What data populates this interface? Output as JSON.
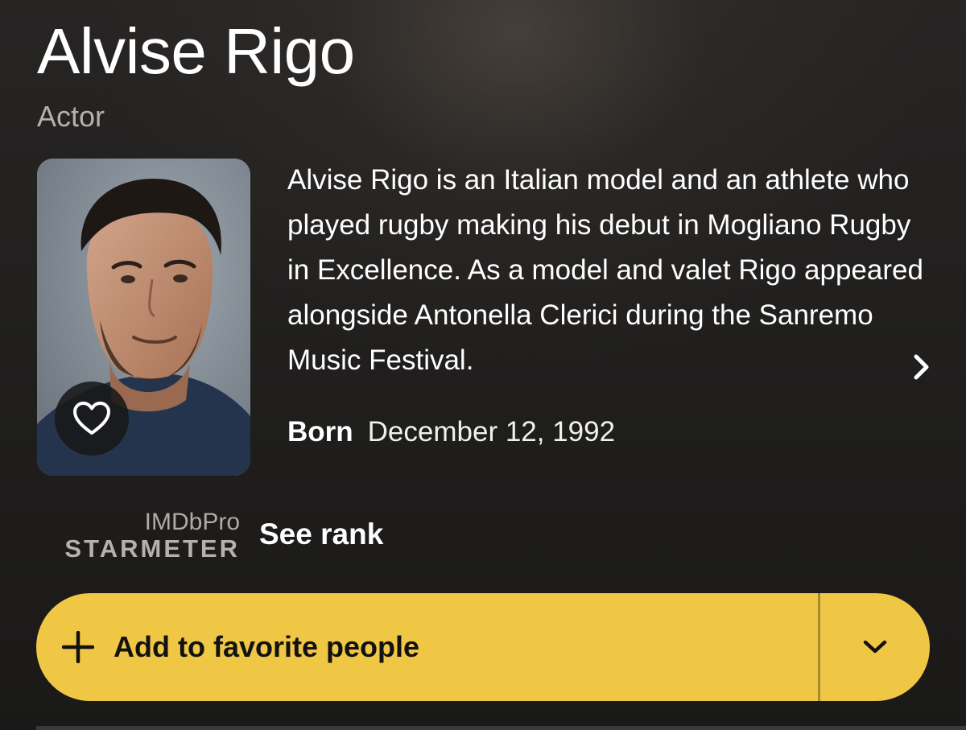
{
  "person": {
    "name": "Alvise Rigo",
    "role": "Actor"
  },
  "bio": {
    "text": "Alvise Rigo is an Italian model and an athlete who played rugby making his debut in Mogliano Rugby in Excellence. As a model and valet Rigo appeared alongside Antonella Clerici during the Sanremo Music Festival."
  },
  "born": {
    "label": "Born",
    "value": "December 12, 1992"
  },
  "starmeter": {
    "brand": "IMDbPro",
    "label": "STARMETER",
    "link": "See rank"
  },
  "favorite_button": {
    "label": "Add to favorite people",
    "icon": "plus-icon",
    "dropdown_icon": "chevron-down-icon"
  },
  "icons": {
    "photo_overlay": "heart-icon",
    "bio_more": "chevron-right-icon"
  },
  "colors": {
    "accent": "#f0c745",
    "background": "#1c1b1a",
    "secondary_text": "#b4b2af"
  }
}
